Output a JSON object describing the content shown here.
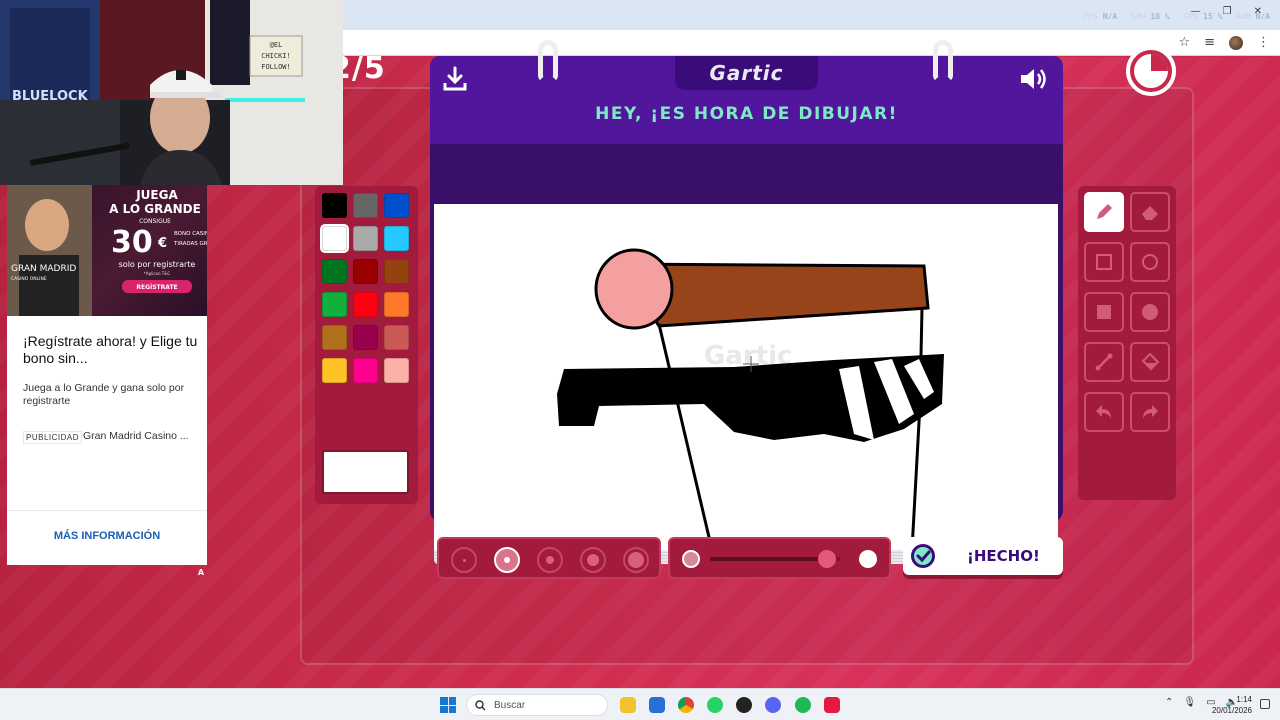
{
  "perf": {
    "fps_label": "FPS",
    "fps_value": "N/A",
    "gpu_label": "GPU",
    "gpu_value": "18 %",
    "cpu_label": "CPU",
    "cpu_value": "15 %",
    "ram_label": "RAM",
    "ram_value": "N/A"
  },
  "game": {
    "round": "2/5",
    "logo": "Gartic",
    "prompt": "HEY, ¡ES HORA DE DIBUJAR!",
    "done_label": "¡HECHO!",
    "palette": [
      "#000000",
      "#666666",
      "#0050cd",
      "#ffffff",
      "#aaaaaa",
      "#26c9ff",
      "#017420",
      "#990000",
      "#964112",
      "#11b03c",
      "#ff0013",
      "#ff7829",
      "#b0701c",
      "#99004e",
      "#cb5a57",
      "#ffc126",
      "#ff008f",
      "#feafa8"
    ],
    "selected_color": "#ffffff",
    "stroke_sizes": [
      "xs",
      "s",
      "m",
      "l",
      "xl"
    ],
    "selected_size": "s",
    "opacity_level": 0.9
  },
  "ad": {
    "banner_headline": "JUEGA A LO GRANDE",
    "banner_sub": "CONSIGUE",
    "banner_amount": "30",
    "banner_currency": "€",
    "banner_bonus1": "BONO CASINO",
    "banner_bonus2": "TIRADAS GRATIS",
    "banner_solo": "solo por registrarte",
    "banner_tc": "*Aplican T&C",
    "banner_button": "REGÍSTRATE",
    "banner_brand": "GRAN MADRID CASINO ONLINE",
    "title": "¡Regístrate ahora! y Elige tu bono sin...",
    "description": "Juega a lo Grande y gana solo por registrarte",
    "tag": "PUBLICIDAD",
    "sponsor": "Gran Madrid Casino ...",
    "cta": "MÁS INFORMACIÓN",
    "badge": "A"
  },
  "webcam": {
    "sign_text": "@EL CHICKI! FOLLOW!",
    "poster_text": "BLUELOCK"
  },
  "taskbar": {
    "search_placeholder": "Buscar",
    "time": "1:14",
    "date": "20/01/2026"
  }
}
